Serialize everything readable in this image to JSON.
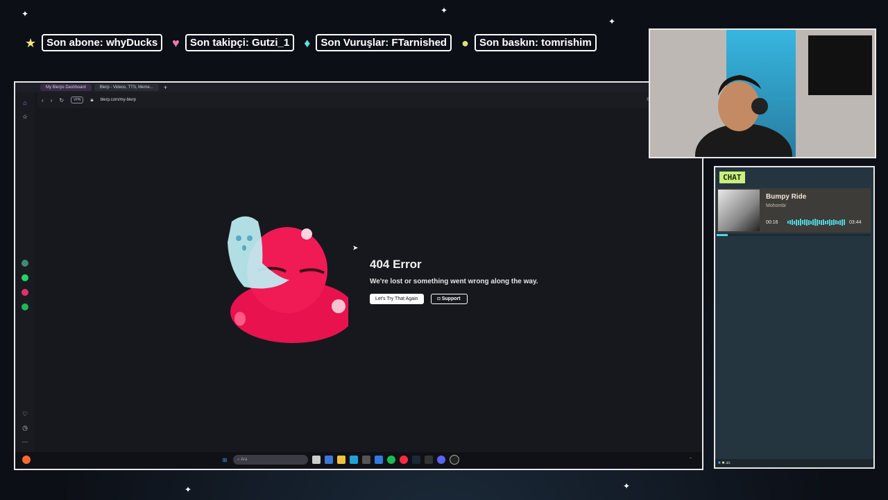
{
  "stats": [
    {
      "icon": "star-icon",
      "glyph": "★",
      "color": "#f4e47a",
      "text": "Son abone: whyDucks"
    },
    {
      "icon": "heart-icon",
      "glyph": "♥",
      "color": "#e97ab0",
      "text": "Son takipçi: Gutzi_1"
    },
    {
      "icon": "diamond-icon",
      "glyph": "♦",
      "color": "#5fe0e0",
      "text": "Son Vuruşlar: FTarnished"
    },
    {
      "icon": "coin-icon",
      "glyph": "●",
      "color": "#e0e07a",
      "text": "Son baskın: tomrishim"
    }
  ],
  "browser": {
    "tabs": [
      "My Blerps Dashboard",
      "Blerp - Videos, TTS, Meme..."
    ],
    "new_tab": "+",
    "vpn": "VPN",
    "url": "blerp.com/my-blerp"
  },
  "error": {
    "title": "404 Error",
    "message": "We're lost or something went wrong along the way.",
    "retry_label": "Let's Try That Again",
    "support_label": "Support"
  },
  "taskbar": {
    "search_placeholder": "Ara"
  },
  "chat": {
    "label": "CHAT",
    "song": "Bumpy Ride",
    "artist": "Mohombi",
    "time_elapsed": "00:16",
    "time_total": "03:44",
    "progress": 0.07,
    "footer_user": "as"
  }
}
